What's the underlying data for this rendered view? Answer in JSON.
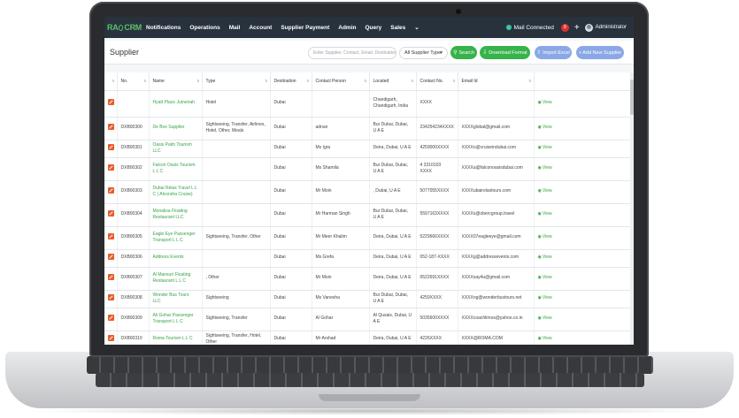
{
  "nav": {
    "logo_text": "RA",
    "logo_text2": "CRM",
    "items": [
      "Notifications",
      "Operations",
      "Mail",
      "Account",
      "Supplier Payment",
      "Admin",
      "Query",
      "Sales"
    ],
    "more_icon": "chevron-down-icon",
    "mail_status": "Mail Connected",
    "notification_count": "9",
    "user": "Administrator"
  },
  "header": {
    "title": "Supplier",
    "search_placeholder": "Enter Supplier, Contact, Email, Destination",
    "supplier_type": "All Supplier Type",
    "search_btn": "Search",
    "download_btn": "Download Format",
    "import_btn": "Import Excel",
    "add_btn": "+ Add New Supplier"
  },
  "table": {
    "columns": [
      "",
      "No.",
      "Name",
      "Type",
      "Destination",
      "Contact Person",
      "Located",
      "Contact No.",
      "Email Id",
      ""
    ],
    "view_label": "View",
    "rows": [
      {
        "no": "",
        "name": "Hyatt Place Jumeirah",
        "type": "Hotel",
        "dest": "Dubai",
        "contact": "",
        "located": "Chandigarh, Chandigarh, India",
        "phone": "XXXX",
        "email": ""
      },
      {
        "no": "DXB00300",
        "name": "De Box Supplier",
        "type": "Sightseeing, Transfer, Airlines, Hotel, Other, Meals",
        "dest": "Dubai",
        "contact": "adnan",
        "located": "Bur Dubai, Dubai, U A E",
        "phone": "234254234XXXX",
        "email": "XXXXglobal@gmail.com"
      },
      {
        "no": "DXB00301",
        "name": "Oasis Palm Tourism LLC",
        "type": "",
        "dest": "Dubai",
        "contact": "Ms Igra",
        "located": "Deira, Dubai, U A E",
        "phone": "4259000XXXX",
        "email": "XXXXo@cruiseindubai.com"
      },
      {
        "no": "DXB00302",
        "name": "Falcon Oasis Tourism L L C",
        "type": "",
        "dest": "Dubai",
        "contact": "Ms Shamila",
        "located": "Bur Dubai, Dubai, U A E",
        "phone": "4 3310103 XXXX",
        "email": "XXXXa@falconoasisdubai.com"
      },
      {
        "no": "DXB00303",
        "name": "Dubai Relax Travel L L C ( Alcondra Cruise)",
        "type": "",
        "dest": "Dubai",
        "contact": "Mr Moin",
        "located": ", Dubai, U A E",
        "phone": "5077055XXXX",
        "email": "XXXXubairelaxtours.com"
      },
      {
        "no": "DXB00304",
        "name": "Monalisa Floating Restaurant LLC",
        "type": "",
        "dest": "Dubai",
        "contact": "Mr Harman Singh",
        "located": "Bur Dubai, Dubai, U A E",
        "phone": "5597163XXXX",
        "email": "XXXXs@obercgroup.travel"
      },
      {
        "no": "DXB00305",
        "name": "Eagle Eye Passenger Transport L L C",
        "type": "Sightseeing, Transfer, Other",
        "dest": "Dubai",
        "contact": "Mr Meer Khalim",
        "located": "Deira, Dubai, U A E",
        "phone": "5229666XXXX",
        "email": "XXXX07eagleeye@gmail.com"
      },
      {
        "no": "DXB00306",
        "name": "Address Events",
        "type": "",
        "dest": "Dubai",
        "contact": "Ms Grefa",
        "located": "Deira, Dubai, U A E",
        "phone": "052-187-XXXX",
        "email": "XXXXg@addressevents.com"
      },
      {
        "no": "DXB00307",
        "name": "Al Mansuri Floating Restaurant L L C",
        "type": ", Other",
        "dest": "Dubai",
        "contact": "Mr Moin",
        "located": "Deira, Dubai, U A E",
        "phone": "0522691XXXX",
        "email": "XXXXsay4u@gmail.com"
      },
      {
        "no": "DXB00308",
        "name": "Wonder Bus Tours LLC",
        "type": "Sightseeing",
        "dest": "Dubai",
        "contact": "Ms Vanesha",
        "located": "Bur Dubai, Dubai, U A E",
        "phone": "4259XXXX",
        "email": "XXXXng@wonderbustours.net"
      },
      {
        "no": "DXB00309",
        "name": "Ali Gohar Passenger Transport L L C",
        "type": "Sightseeing, Transfer",
        "dest": "Dubai",
        "contact": "Al Gohar",
        "located": "Al Qusais, Dubai, U A E",
        "phone": "5035600XXXX",
        "email": "XXXXcoachlimos@yahoo.co.in"
      },
      {
        "no": "DXB00310",
        "name": "Roma Tourism L L C",
        "type": "Sightseeing, Transfer, Hotel, Other",
        "dest": "Dubai",
        "contact": "Mr Arshad",
        "located": "Deira, Dubai, U A E",
        "phone": "4226XXXX",
        "email": "XXXX@ROMA.COM"
      }
    ]
  }
}
